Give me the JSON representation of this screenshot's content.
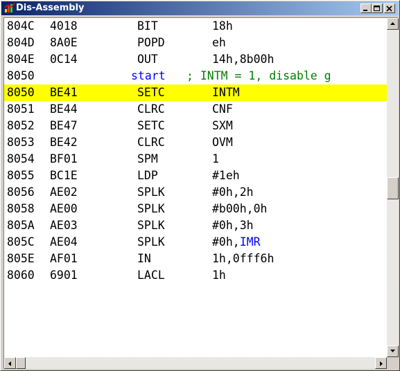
{
  "window": {
    "title": "Dis-Assembly"
  },
  "icons": {
    "app": "dis-assembly-app-icon",
    "minimize": "minimize-icon",
    "maximize": "maximize-icon",
    "close": "close-icon",
    "scroll_up": "arrow-up-icon",
    "scroll_down": "arrow-down-icon",
    "scroll_left": "arrow-left-icon",
    "scroll_right": "arrow-right-icon"
  },
  "colors": {
    "highlight": "#ffff00",
    "label": "#0000ff",
    "comment": "#008000",
    "symbol": "#0000ff",
    "titlebar": "#0a246a"
  },
  "listing": {
    "rows": [
      {
        "addr": "804C",
        "opcode": "4018",
        "mnemonic": "BIT",
        "operands": "18h"
      },
      {
        "addr": "804D",
        "opcode": "8A0E",
        "mnemonic": "POPD",
        "operands": "eh"
      },
      {
        "addr": "804E",
        "opcode": "0C14",
        "mnemonic": "OUT",
        "operands": "14h,8b00h"
      },
      {
        "addr": "8050",
        "label": "start",
        "comment": "; INTM = 1, disable g"
      },
      {
        "addr": "8050",
        "opcode": "BE41",
        "mnemonic": "SETC",
        "operands": "INTM",
        "current": true
      },
      {
        "addr": "8051",
        "opcode": "BE44",
        "mnemonic": "CLRC",
        "operands": "CNF"
      },
      {
        "addr": "8052",
        "opcode": "BE47",
        "mnemonic": "SETC",
        "operands": "SXM"
      },
      {
        "addr": "8053",
        "opcode": "BE42",
        "mnemonic": "CLRC",
        "operands": "OVM"
      },
      {
        "addr": "8054",
        "opcode": "BF01",
        "mnemonic": "SPM",
        "operands": "1"
      },
      {
        "addr": "8055",
        "opcode": "BC1E",
        "mnemonic": "LDP",
        "operands": "#1eh"
      },
      {
        "addr": "8056",
        "opcode": "AE02",
        "mnemonic": "SPLK",
        "operands": "#0h,2h"
      },
      {
        "addr": "8058",
        "opcode": "AE00",
        "mnemonic": "SPLK",
        "operands": "#b00h,0h"
      },
      {
        "addr": "805A",
        "opcode": "AE03",
        "mnemonic": "SPLK",
        "operands": "#0h,3h"
      },
      {
        "addr": "805C",
        "opcode": "AE04",
        "mnemonic": "SPLK",
        "operands": "#0h,",
        "symbol": "IMR"
      },
      {
        "addr": "805E",
        "opcode": "AF01",
        "mnemonic": "IN",
        "operands": "1h,0fff6h"
      },
      {
        "addr": "8060",
        "opcode": "6901",
        "mnemonic": "LACL",
        "operands": "1h"
      }
    ]
  }
}
